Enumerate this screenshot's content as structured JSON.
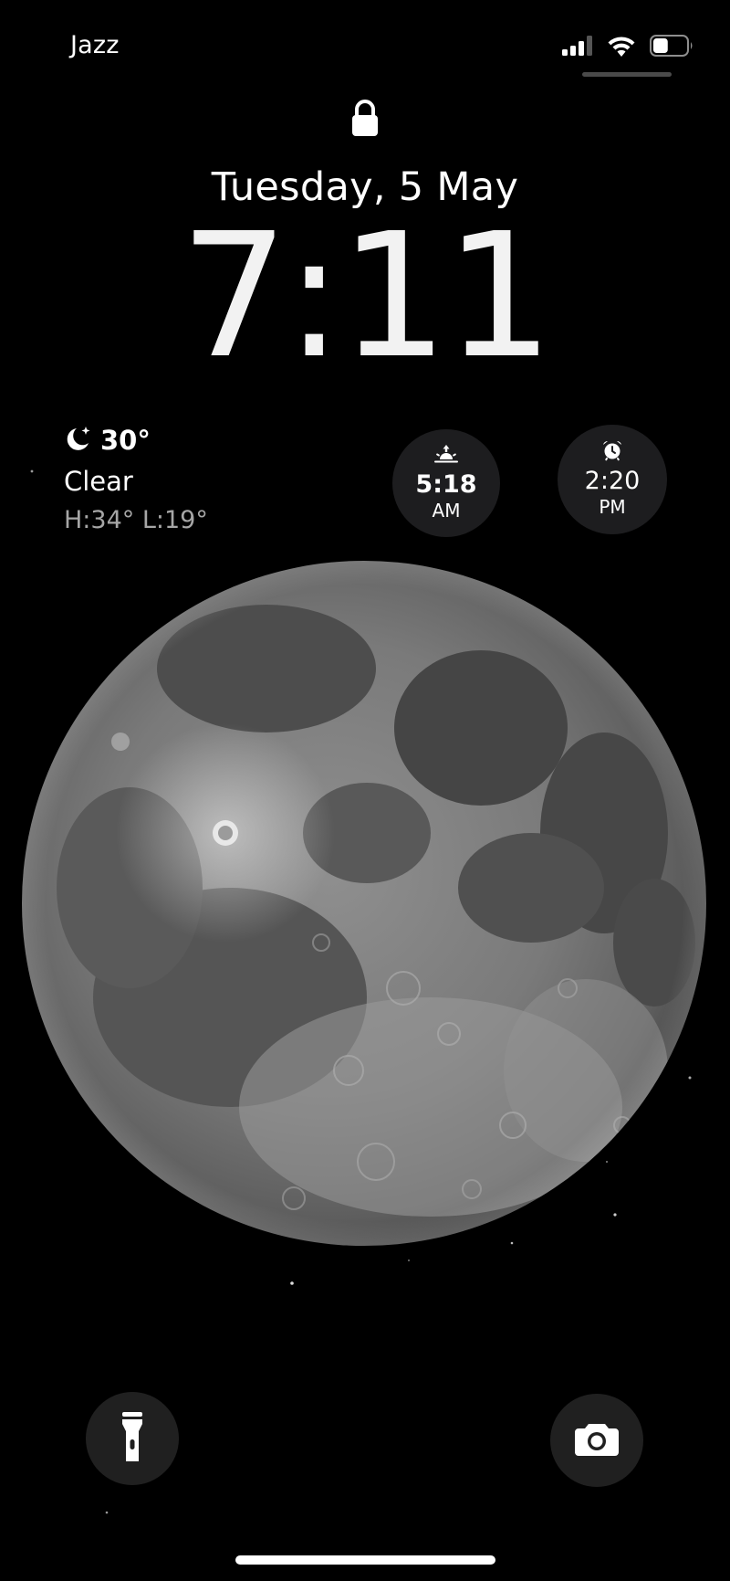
{
  "status_bar": {
    "carrier": "Jazz",
    "signal_icon": "cellular-signal-icon",
    "wifi_icon": "wifi-icon",
    "battery_icon": "battery-icon",
    "battery_level": 0.45
  },
  "lock": {
    "icon": "lock-icon"
  },
  "date": "Tuesday, 5 May",
  "time": "7:11",
  "weather": {
    "icon": "moon-stars-icon",
    "temperature": "30°",
    "condition": "Clear",
    "high_low": "H:34° L:19°"
  },
  "widgets": {
    "sunrise": {
      "icon": "sunrise-icon",
      "time": "5:18",
      "period": "AM"
    },
    "alarm": {
      "icon": "alarm-clock-icon",
      "time": "2:20",
      "period": "PM"
    }
  },
  "wallpaper": {
    "subject": "moon-image"
  },
  "quick_actions": {
    "flashlight": {
      "icon": "flashlight-icon"
    },
    "camera": {
      "icon": "camera-icon"
    }
  },
  "colors": {
    "background": "#000000",
    "widget_bg": "#1d1d1f",
    "secondary_text": "#a6a6a6"
  }
}
